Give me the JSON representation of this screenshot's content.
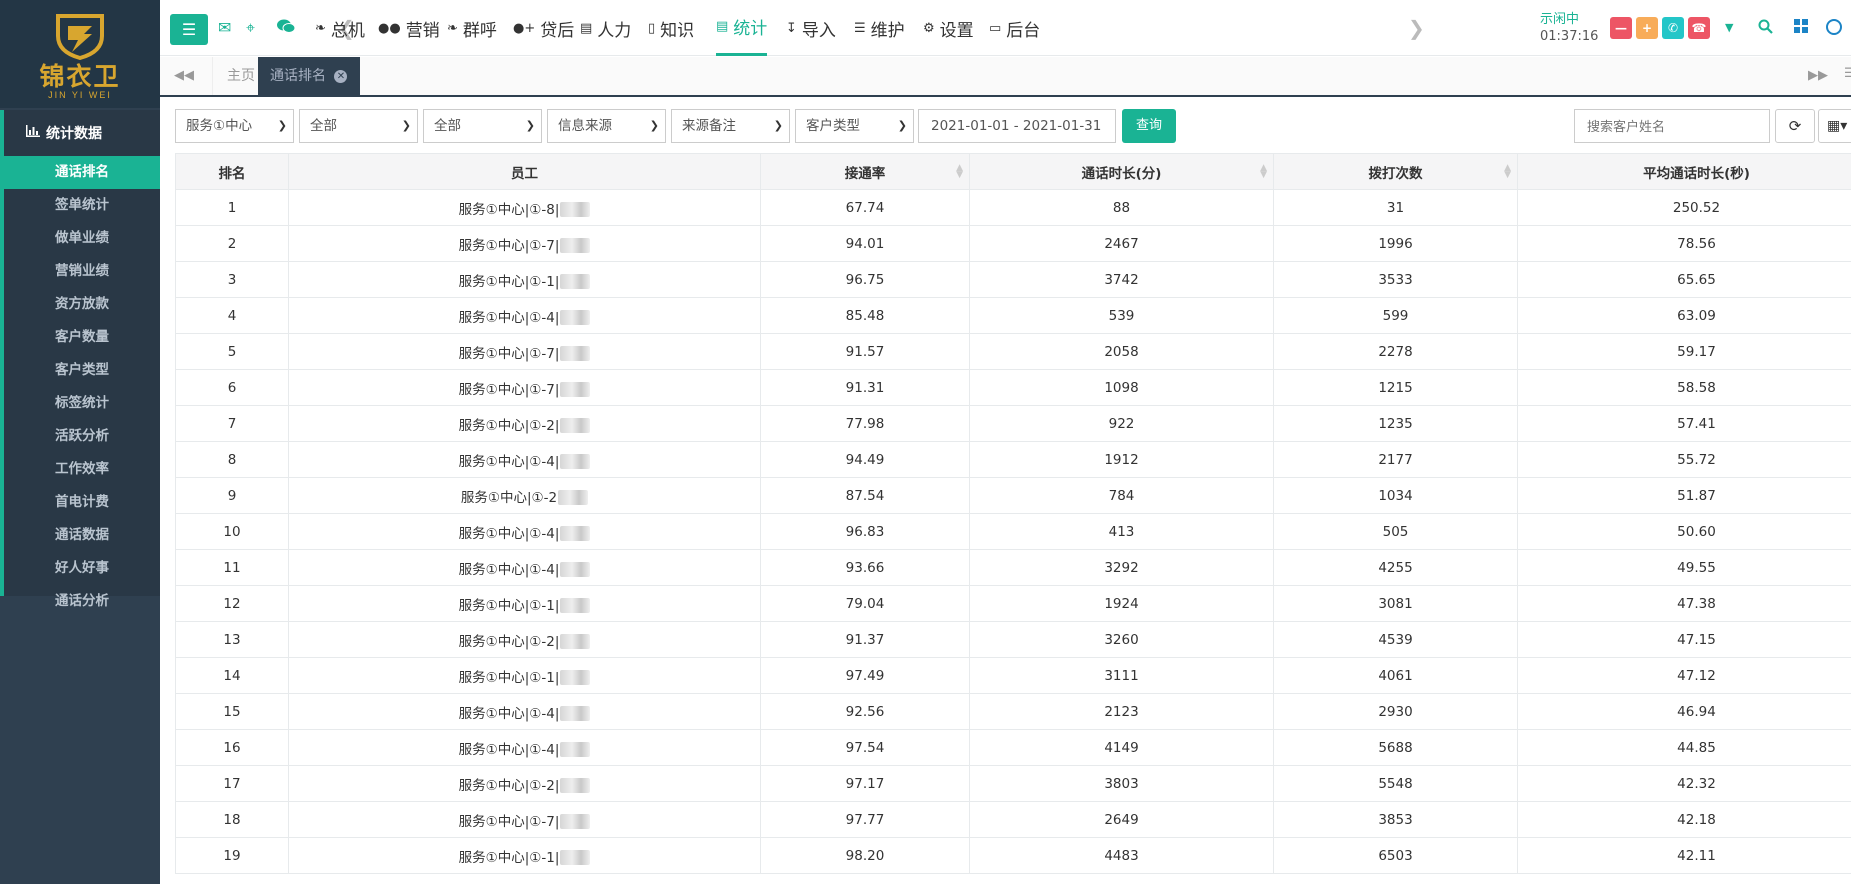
{
  "brand": {
    "name_cn": "锦衣卫",
    "name_en": "JIN YI WEI",
    "color": "#d8a62f"
  },
  "colors": {
    "accent": "#1ab394",
    "sidebar": "#2f4050",
    "danger": "#ed5565",
    "warning": "#f8ac59",
    "info": "#23c6c8"
  },
  "sidebar": {
    "section_title": "统计数据",
    "items": [
      {
        "label": "通话排名",
        "active": true
      },
      {
        "label": "签单统计"
      },
      {
        "label": "做单业绩"
      },
      {
        "label": "营销业绩"
      },
      {
        "label": "资方放款"
      },
      {
        "label": "客户数量"
      },
      {
        "label": "客户类型"
      },
      {
        "label": "标签统计"
      },
      {
        "label": "活跃分析"
      },
      {
        "label": "工作效率"
      },
      {
        "label": "首电计费"
      },
      {
        "label": "通话数据"
      },
      {
        "label": "好人好事"
      },
      {
        "label": "通话分析"
      }
    ]
  },
  "topbar": {
    "menus": [
      {
        "label": "总机",
        "icon": "phone-volume-icon"
      },
      {
        "label": "营销",
        "icon": "users-icon"
      },
      {
        "label": "群呼",
        "icon": "broadcast-icon"
      },
      {
        "label": "贷后",
        "icon": "user-plus-icon"
      },
      {
        "label": "人力",
        "icon": "id-card-icon"
      },
      {
        "label": "知识",
        "icon": "book-icon"
      },
      {
        "label": "统计",
        "icon": "bar-chart-icon",
        "active": true
      },
      {
        "label": "导入",
        "icon": "download-icon"
      },
      {
        "label": "维护",
        "icon": "database-icon"
      },
      {
        "label": "设置",
        "icon": "gear-icon"
      },
      {
        "label": "后台",
        "icon": "desktop-icon"
      }
    ],
    "status": {
      "label": "示闲中",
      "time": "01:37:16"
    }
  },
  "tabs": {
    "home": "主页",
    "active": "通话排名"
  },
  "filters": {
    "center": "服务①中心",
    "dept": "全部",
    "group": "全部",
    "info_source": "信息来源",
    "source_note": "来源备注",
    "customer_type": "客户类型",
    "date_range": "2021-01-01 - 2021-01-31",
    "query_label": "查询",
    "search_placeholder": "搜索客户姓名"
  },
  "table": {
    "columns": [
      "排名",
      "员工",
      "接通率",
      "通话时长(分)",
      "拨打次数",
      "平均通话时长(秒)"
    ],
    "rows": [
      {
        "rank": "1",
        "employee": "服务①中心|①-8|",
        "rate": "67.74",
        "duration": "88",
        "dials": "31",
        "avg": "250.52"
      },
      {
        "rank": "2",
        "employee": "服务①中心|①-7|",
        "rate": "94.01",
        "duration": "2467",
        "dials": "1996",
        "avg": "78.56"
      },
      {
        "rank": "3",
        "employee": "服务①中心|①-1|",
        "rate": "96.75",
        "duration": "3742",
        "dials": "3533",
        "avg": "65.65"
      },
      {
        "rank": "4",
        "employee": "服务①中心|①-4|",
        "rate": "85.48",
        "duration": "539",
        "dials": "599",
        "avg": "63.09"
      },
      {
        "rank": "5",
        "employee": "服务①中心|①-7|",
        "rate": "91.57",
        "duration": "2058",
        "dials": "2278",
        "avg": "59.17"
      },
      {
        "rank": "6",
        "employee": "服务①中心|①-7|",
        "rate": "91.31",
        "duration": "1098",
        "dials": "1215",
        "avg": "58.58"
      },
      {
        "rank": "7",
        "employee": "服务①中心|①-2|",
        "rate": "77.98",
        "duration": "922",
        "dials": "1235",
        "avg": "57.41"
      },
      {
        "rank": "8",
        "employee": "服务①中心|①-4|",
        "rate": "94.49",
        "duration": "1912",
        "dials": "2177",
        "avg": "55.72"
      },
      {
        "rank": "9",
        "employee": "服务①中心|①-2",
        "rate": "87.54",
        "duration": "784",
        "dials": "1034",
        "avg": "51.87"
      },
      {
        "rank": "10",
        "employee": "服务①中心|①-4|",
        "rate": "96.83",
        "duration": "413",
        "dials": "505",
        "avg": "50.60"
      },
      {
        "rank": "11",
        "employee": "服务①中心|①-4|",
        "rate": "93.66",
        "duration": "3292",
        "dials": "4255",
        "avg": "49.55"
      },
      {
        "rank": "12",
        "employee": "服务①中心|①-1|",
        "rate": "79.04",
        "duration": "1924",
        "dials": "3081",
        "avg": "47.38"
      },
      {
        "rank": "13",
        "employee": "服务①中心|①-2|",
        "rate": "91.37",
        "duration": "3260",
        "dials": "4539",
        "avg": "47.15"
      },
      {
        "rank": "14",
        "employee": "服务①中心|①-1|",
        "rate": "97.49",
        "duration": "3111",
        "dials": "4061",
        "avg": "47.12"
      },
      {
        "rank": "15",
        "employee": "服务①中心|①-4|",
        "rate": "92.56",
        "duration": "2123",
        "dials": "2930",
        "avg": "46.94"
      },
      {
        "rank": "16",
        "employee": "服务①中心|①-4|",
        "rate": "97.54",
        "duration": "4149",
        "dials": "5688",
        "avg": "44.85"
      },
      {
        "rank": "17",
        "employee": "服务①中心|①-2|",
        "rate": "97.17",
        "duration": "3803",
        "dials": "5548",
        "avg": "42.32"
      },
      {
        "rank": "18",
        "employee": "服务①中心|①-7|",
        "rate": "97.77",
        "duration": "2649",
        "dials": "3853",
        "avg": "42.18"
      },
      {
        "rank": "19",
        "employee": "服务①中心|①-1|",
        "rate": "98.20",
        "duration": "4483",
        "dials": "6503",
        "avg": "42.11"
      }
    ]
  }
}
